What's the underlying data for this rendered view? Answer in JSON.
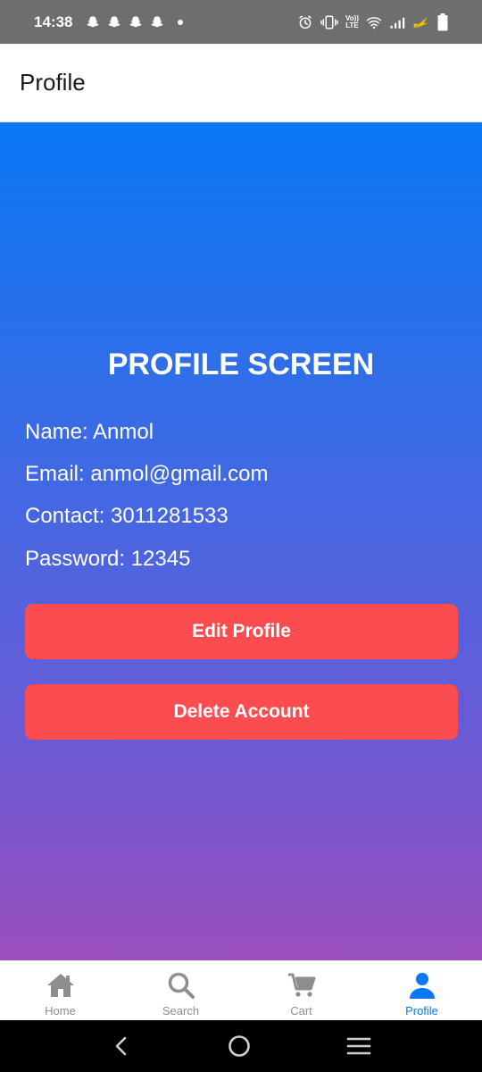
{
  "status_bar": {
    "time": "14:38",
    "left_icons": [
      "snapchat-icon",
      "snapchat-icon",
      "snapchat-icon",
      "snapchat-icon",
      "dot-icon"
    ],
    "right_icons": [
      "alarm-icon",
      "vibrate-icon",
      "volte-icon",
      "wifi-icon",
      "signal-icon",
      "charging-icon",
      "battery-icon"
    ],
    "volte_line1": "Vo))",
    "volte_line2": "LTE"
  },
  "header": {
    "title": "Profile"
  },
  "profile": {
    "screen_title": "PROFILE SCREEN",
    "name_line": "Name: Anmol",
    "email_line": "Email: anmol@gmail.com",
    "contact_line": "Contact: 3011281533",
    "password_line": "Password: 12345",
    "edit_button": "Edit Profile",
    "delete_button": "Delete Account"
  },
  "tabs": [
    {
      "label": "Home",
      "icon": "home-icon",
      "active": false
    },
    {
      "label": "Search",
      "icon": "search-icon",
      "active": false
    },
    {
      "label": "Cart",
      "icon": "cart-icon",
      "active": false
    },
    {
      "label": "Profile",
      "icon": "person-icon",
      "active": true
    }
  ],
  "colors": {
    "accent": "#0a78f5",
    "button": "#fb4d50",
    "gradient_top": "#0a78f5",
    "gradient_bottom": "#9a4fbd",
    "inactive_tab": "#8e8e8e"
  },
  "nav_bar": {
    "icons": [
      "back-icon",
      "home-circle-icon",
      "recents-icon"
    ]
  }
}
